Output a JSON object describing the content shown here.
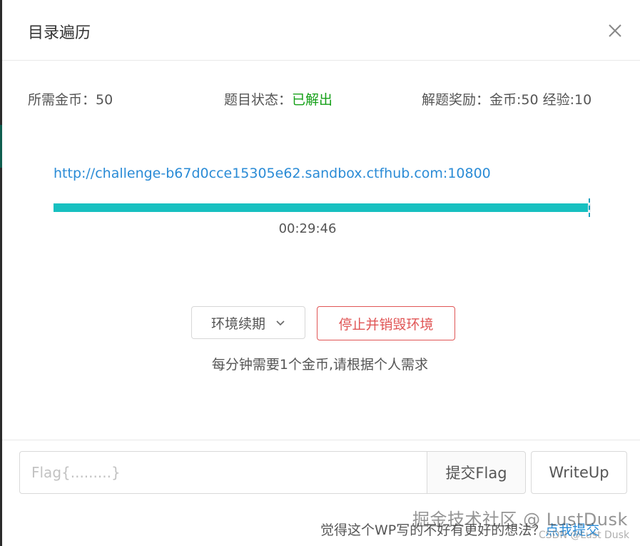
{
  "dialog": {
    "title": "目录遍历",
    "close_icon": "close-icon"
  },
  "info": {
    "coins_needed": "所需金币：50",
    "status_label": "题目状态：",
    "status_value": "已解出",
    "reward": "解题奖励：金币:50 经验:10"
  },
  "challenge": {
    "url": "http://challenge-b67d0cce15305e62.sandbox.ctfhub.com:10800",
    "progress": 0.995,
    "timer": "00:29:46"
  },
  "actions": {
    "renew_label": "环境续期",
    "renew_icon": "chevron-down-icon",
    "destroy_label": "停止并销毁环境",
    "note": "每分钟需要1个金币,请根据个人需求"
  },
  "flag": {
    "placeholder": "Flag{.........}",
    "value": "",
    "submit_label": "提交Flag",
    "writeup_label": "WriteUp"
  },
  "footer": {
    "prompt": "觉得这个WP写的不好有更好的想法？",
    "link": "点我提交"
  },
  "watermark": {
    "main": "掘金技术社区 @ LustDusk",
    "sub": "CSDN @Lust Dusk"
  },
  "colors": {
    "status_green": "#15a018",
    "link_blue": "#2a8bd6",
    "progress_teal": "#17c0c0",
    "danger_red": "#e05555"
  }
}
